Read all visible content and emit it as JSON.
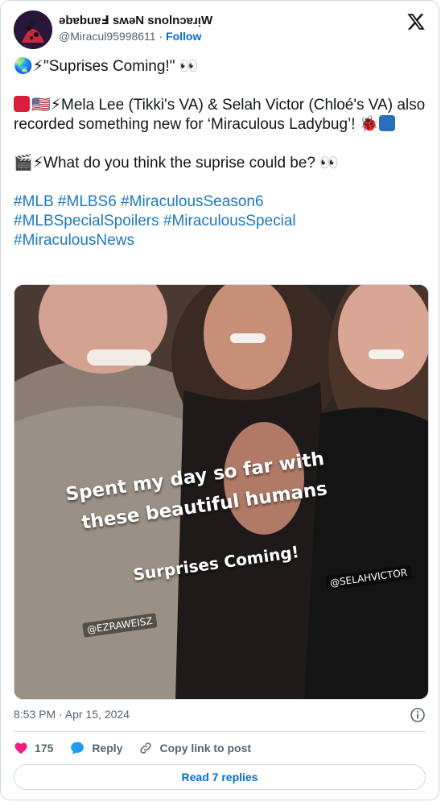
{
  "author": {
    "display_name": "ǝbɐbuɐℲ sʍǝN snolnɔɐɹᴉW",
    "handle": "@Miracul95998611",
    "separator": "·",
    "follow_label": "Follow"
  },
  "tweet": {
    "line1": "\"Suprises Coming!\" 👀",
    "line2": "Mela Lee (Tikki's VA) & Selah Victor (Chloé's VA) also recorded something new for ‘Miraculous Ladybug’! ",
    "line3": "What do you think the suprise could be? 👀",
    "hashtags": [
      "#MLB",
      "#MLBS6",
      "#MiraculousSeason6",
      "#MLBSpecialSpoilers",
      "#MiraculousSpecial",
      "#MiraculousNews"
    ],
    "emoji": {
      "globe": "🌏",
      "bolt": "⚡",
      "flag": "🇺🇸",
      "bug": "🐞",
      "clapper": "🎬"
    }
  },
  "photo": {
    "caption_line1": "Spent my day so far with",
    "caption_line2": "these beautiful humans",
    "caption_line3": "Surprises Coming!",
    "tag_left": "@EZRAWEISZ",
    "tag_right": "@SELAHVICTOR"
  },
  "meta": {
    "timestamp": "8:53 PM · Apr 15, 2024"
  },
  "actions": {
    "like_count": "175",
    "reply_label": "Reply",
    "copy_label": "Copy link to post",
    "read_replies_label": "Read 7 replies"
  },
  "colors": {
    "link": "#1d78c1",
    "follow": "#006fd6",
    "like": "#f91880",
    "reply": "#1d9bf0"
  }
}
